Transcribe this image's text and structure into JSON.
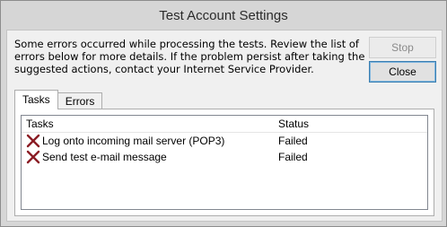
{
  "window": {
    "title": "Test Account Settings"
  },
  "message": "Some errors occurred while processing the tests. Review the list of errors below for more details. If the problem persist after taking the suggested actions, contact your Internet Service Provider.",
  "buttons": {
    "stop": "Stop",
    "close": "Close"
  },
  "tabs": [
    {
      "label": "Tasks"
    },
    {
      "label": "Errors"
    }
  ],
  "list": {
    "headers": {
      "task": "Tasks",
      "status": "Status"
    },
    "rows": [
      {
        "task": "Log onto incoming mail server (POP3)",
        "status": "Failed",
        "icon": "error-x-icon"
      },
      {
        "task": "Send test e-mail message",
        "status": "Failed",
        "icon": "error-x-icon"
      }
    ]
  },
  "colors": {
    "error_x": "#8b1c24",
    "close_border": "#3c7fb1"
  }
}
